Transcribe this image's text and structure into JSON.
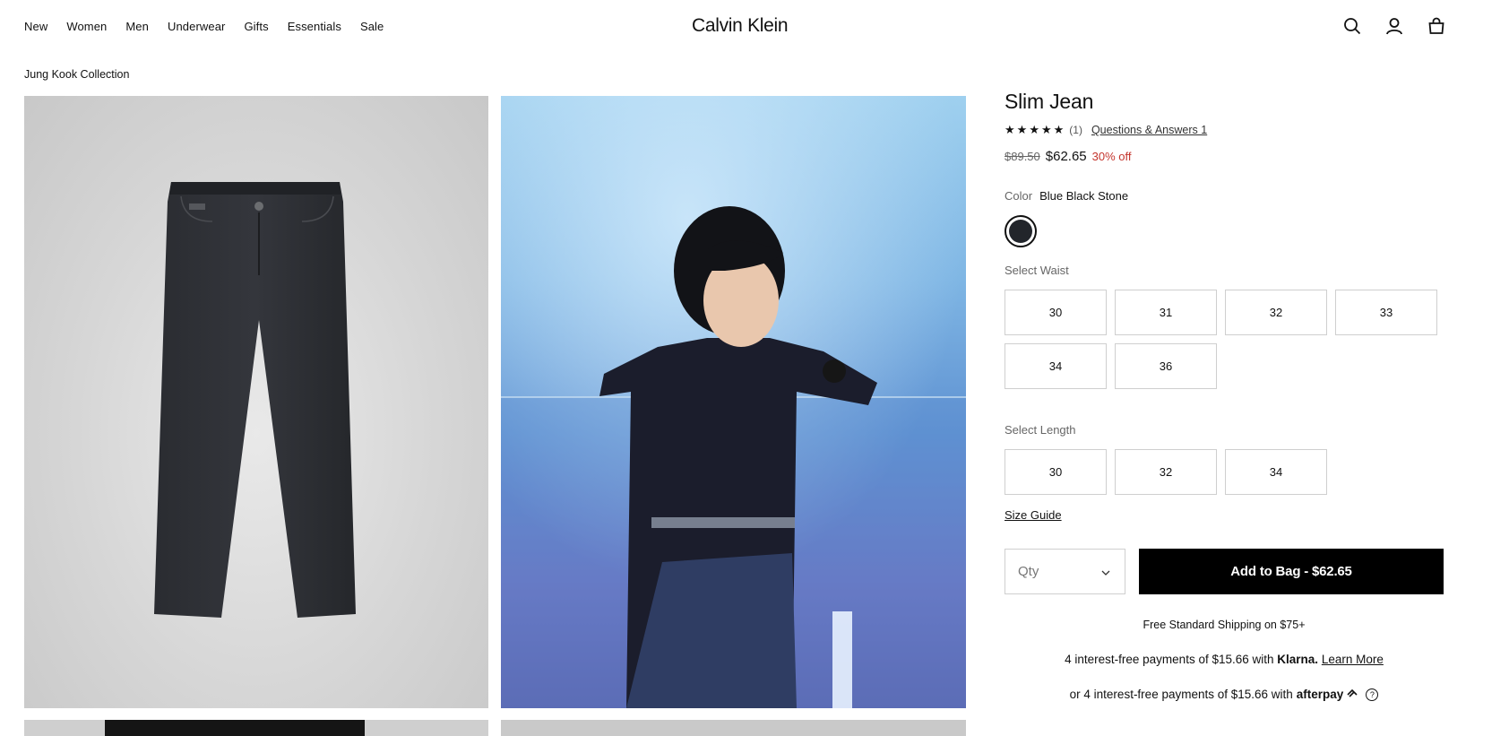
{
  "header": {
    "nav": [
      "New",
      "Women",
      "Men",
      "Underwear",
      "Gifts",
      "Essentials",
      "Sale"
    ],
    "logo": "Calvin Klein",
    "icons": [
      "search-icon",
      "account-icon",
      "bag-icon"
    ]
  },
  "breadcrumb": "Jung Kook Collection",
  "product": {
    "title": "Slim Jean",
    "rating_stars": 5,
    "review_count": "(1)",
    "qa_link": "Questions & Answers 1",
    "old_price": "$89.50",
    "price": "$62.65",
    "discount": "30% off",
    "color_label": "Color",
    "color_value": "Blue Black Stone",
    "swatch_color": "#22252b",
    "waist_label": "Select Waist",
    "waist_sizes": [
      "30",
      "31",
      "32",
      "33",
      "34",
      "36"
    ],
    "length_label": "Select Length",
    "length_sizes": [
      "30",
      "32",
      "34"
    ],
    "size_guide": "Size Guide",
    "qty_placeholder": "Qty",
    "add_to_bag": "Add to Bag - $62.65",
    "shipping": "Free Standard Shipping on $75+",
    "klarna_text": "4 interest-free payments of $15.66 with",
    "klarna_brand": "Klarna.",
    "klarna_link": "Learn More",
    "afterpay_text": "or 4 interest-free payments of $15.66 with",
    "afterpay_brand": "afterpay",
    "help_icon_glyph": "?"
  },
  "colors": {
    "sale_red": "#c4352d",
    "button_black": "#000000"
  }
}
